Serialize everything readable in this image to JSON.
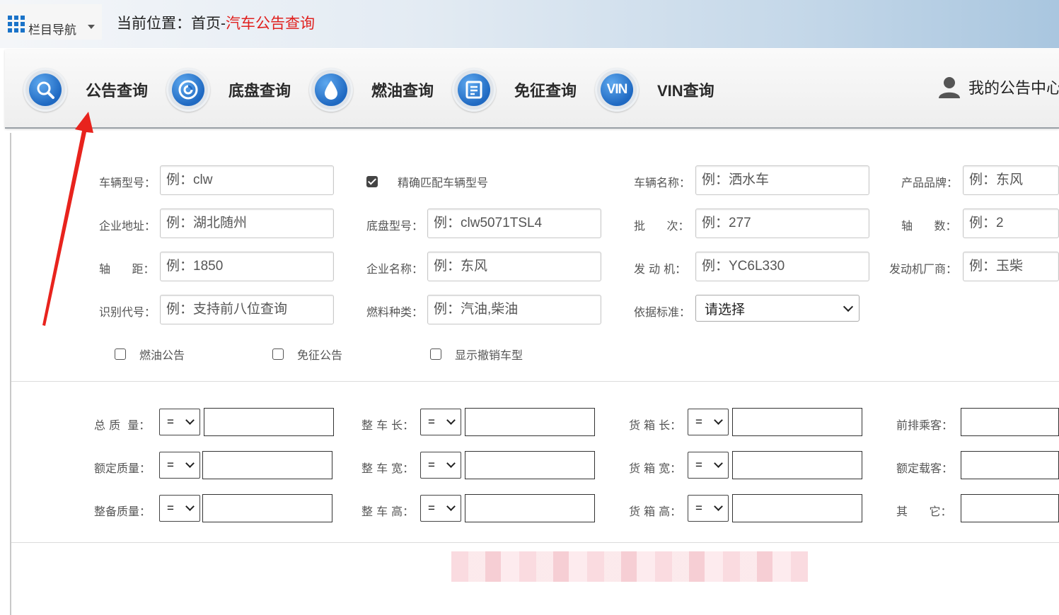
{
  "topbar": {
    "nav_label": "栏目导航",
    "breadcrumb_prefix": "当前位置：首页-",
    "breadcrumb_current": "汽车公告查询"
  },
  "toolbar": {
    "items": [
      {
        "label": "公告查询",
        "icon": "search-icon"
      },
      {
        "label": "底盘查询",
        "icon": "target-icon"
      },
      {
        "label": "燃油查询",
        "icon": "drop-icon"
      },
      {
        "label": "免征查询",
        "icon": "document-icon"
      },
      {
        "label": "VIN查询",
        "icon": "vin-icon",
        "icon_text": "VIN"
      }
    ],
    "user_label": "我的公告中心"
  },
  "form": {
    "vehicle_model": {
      "label": "车辆型号：",
      "placeholder": "例：clw"
    },
    "exact_match": {
      "label": "精确匹配车辆型号",
      "checked": true
    },
    "vehicle_name": {
      "label": "车辆名称：",
      "placeholder": "例：洒水车"
    },
    "brand": {
      "label": "产品品牌：",
      "placeholder": "例：东风"
    },
    "company_address": {
      "label": "企业地址：",
      "placeholder": "例：湖北随州"
    },
    "chassis_model": {
      "label": "底盘型号：",
      "placeholder": "例：clw5071TSL4"
    },
    "batch": {
      "label": "批      次：",
      "placeholder": "例：277"
    },
    "axles": {
      "label": "轴      数：",
      "placeholder": "例：2"
    },
    "wheelbase": {
      "label": "轴      距：",
      "placeholder": "例：1850"
    },
    "company_name": {
      "label": "企业名称：",
      "placeholder": "例：东风"
    },
    "engine": {
      "label": "发 动 机：",
      "placeholder": "例：YC6L330"
    },
    "engine_maker": {
      "label": "发动机厂商：",
      "placeholder": "例：玉柴"
    },
    "vin_code": {
      "label": "识别代号：",
      "placeholder": "例：支持前八位查询"
    },
    "fuel_type": {
      "label": "燃料种类：",
      "placeholder": "例：汽油,柴油"
    },
    "standard": {
      "label": "依据标准：",
      "value": "请选择"
    },
    "checkboxes": [
      {
        "label": "燃油公告",
        "checked": false
      },
      {
        "label": "免征公告",
        "checked": false
      },
      {
        "label": "显示撤销车型",
        "checked": false
      }
    ]
  },
  "dims": {
    "operator": "=",
    "rows": [
      [
        "总 质  量：",
        "整 车 长：",
        "货 箱 长：",
        "前排乘客："
      ],
      [
        "额定质量：",
        "整 车 宽：",
        "货 箱 宽：",
        "额定载客："
      ],
      [
        "整备质量：",
        "整 车 高：",
        "货 箱 高：",
        "其      它："
      ]
    ]
  },
  "colors": {
    "accent_blue": "#1f69c2",
    "breadcrumb_red": "#e0211f",
    "annotation_arrow": "#e8231d"
  }
}
